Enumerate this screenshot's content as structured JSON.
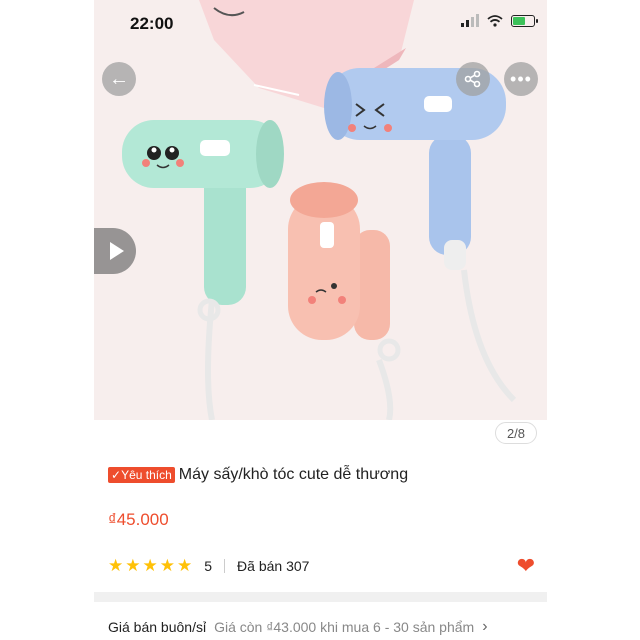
{
  "status_bar": {
    "time": "22:00",
    "icons": [
      "signal-icon",
      "wifi-icon",
      "battery-charging-icon"
    ]
  },
  "hero": {
    "image_counter": "2/8",
    "buttons": [
      "back-arrow-icon",
      "share-icon",
      "more-icon",
      "play-icon"
    ]
  },
  "product": {
    "badge": "Yêu thích",
    "title": "Máy sấy/khò tóc cute dễ thương",
    "price": "₫45.000",
    "rating_value": 5,
    "rating_text": "5",
    "sold": "Đã bán 307"
  },
  "wholesale": {
    "label": "Giá bán buôn/sỉ",
    "value": "Giá còn ₫43.000 khi mua 6 - 30 sản phẩm"
  },
  "colors": {
    "accent": "#ee4d2d",
    "star": "#ffc107",
    "mint": "#a9e2cf",
    "pink": "#f6b9a9",
    "blue": "#a9c4ec"
  }
}
